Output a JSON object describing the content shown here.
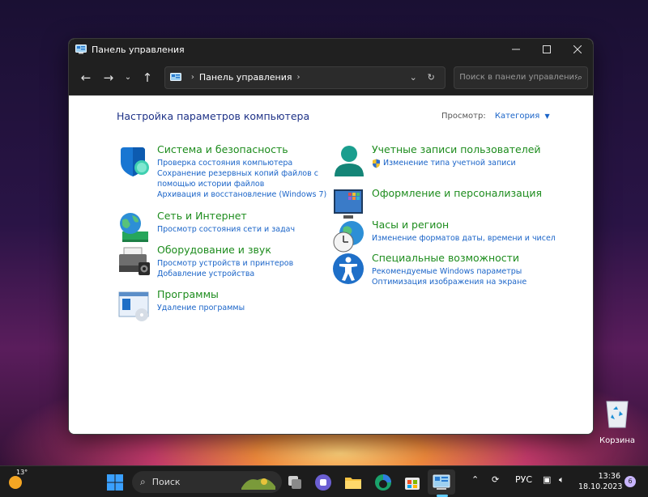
{
  "window": {
    "title": "Панель управления",
    "address": "Панель управления",
    "search_placeholder": "Поиск в панели управления"
  },
  "content": {
    "heading": "Настройка параметров компьютера",
    "viewby_label": "Просмотр:",
    "viewby_value": "Категория",
    "left": [
      {
        "title": "Система и безопасность",
        "icon": "shield-icon",
        "links": [
          "Проверка состояния компьютера",
          "Сохранение резервных копий файлов с",
          "помощью истории файлов",
          "Архивация и восстановление (Windows 7)"
        ]
      },
      {
        "title": "Сеть и Интернет",
        "icon": "network-globe-icon",
        "links": [
          "Просмотр состояния сети и задач"
        ]
      },
      {
        "title": "Оборудование и звук",
        "icon": "printer-icon",
        "links": [
          "Просмотр устройств и принтеров",
          "Добавление устройства"
        ]
      },
      {
        "title": "Программы",
        "icon": "programs-icon",
        "links": [
          "Удаление программы"
        ]
      }
    ],
    "right": [
      {
        "title": "Учетные записи пользователей",
        "icon": "user-accounts-icon",
        "links": [
          "Изменение типа учетной записи"
        ]
      },
      {
        "title": "Оформление и персонализация",
        "icon": "personalization-icon",
        "links": []
      },
      {
        "title": "Часы и регион",
        "icon": "clock-globe-icon",
        "links": [
          "Изменение форматов даты, времени и чисел"
        ]
      },
      {
        "title": "Специальные возможности",
        "icon": "accessibility-icon",
        "links": [
          "Рекомендуемые Windows параметры",
          "Оптимизация изображения на экране"
        ]
      }
    ]
  },
  "desktop": {
    "recycle_bin_label": "Корзина"
  },
  "taskbar": {
    "temperature": "13°",
    "search_label": "Поиск",
    "language": "РУС",
    "time": "13:36",
    "date": "18.10.2023",
    "notification_count": "6"
  },
  "colors": {
    "category_title": "#1d8c1d",
    "link": "#1a64c8",
    "heading": "#1e3287",
    "titlebar": "#202020"
  }
}
